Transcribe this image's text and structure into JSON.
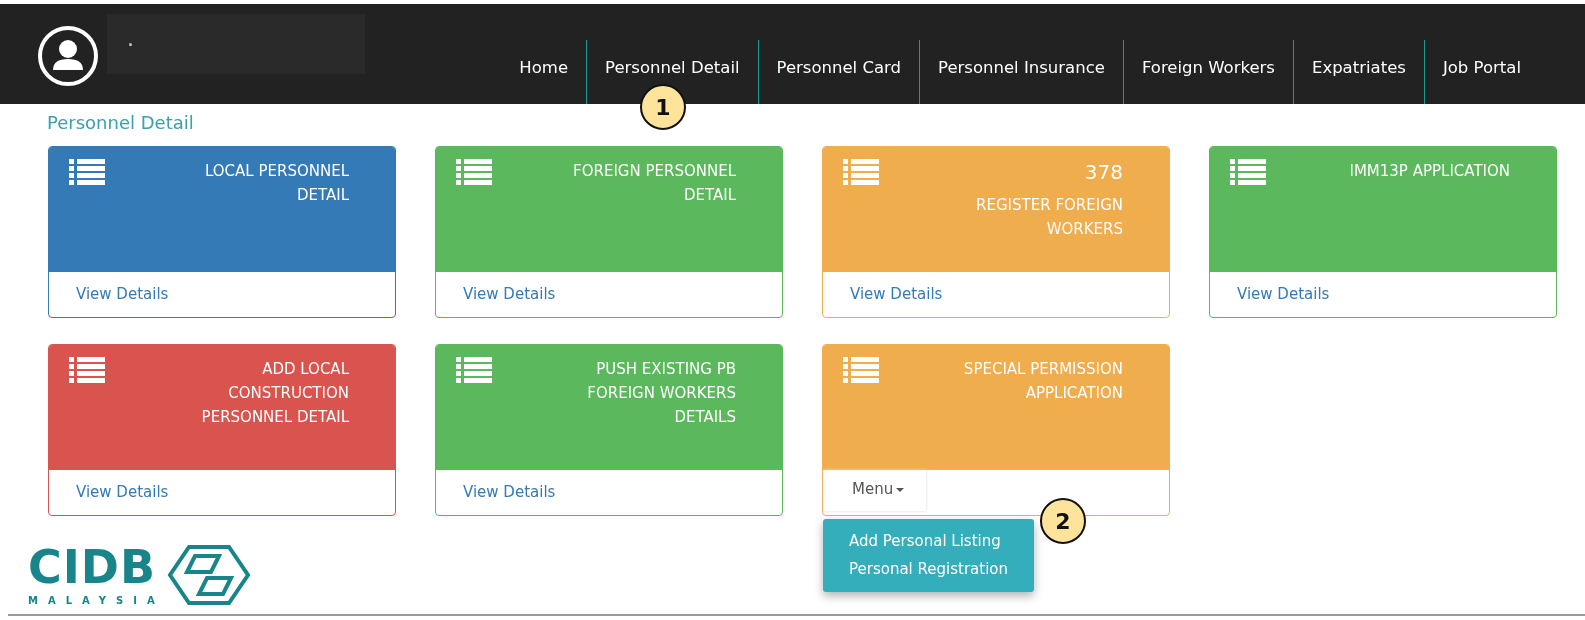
{
  "header": {
    "user_name": "."
  },
  "nav": [
    {
      "label": "Home",
      "selected": false
    },
    {
      "label": "Personnel Detail",
      "selected": false
    },
    {
      "label": "Personnel Card",
      "selected": false
    },
    {
      "label": "Personnel Insurance",
      "selected": false
    },
    {
      "label": "Foreign Workers",
      "selected": false
    },
    {
      "label": "Expatriates",
      "selected": false
    },
    {
      "label": "Job Portal",
      "selected": false
    }
  ],
  "page_title": "Personnel Detail",
  "cards": [
    {
      "title": "LOCAL PERSONNEL DETAIL",
      "color": "#337ab7",
      "footer": {
        "kind": "link",
        "label": "View Details"
      }
    },
    {
      "title": "FOREIGN PERSONNEL DETAIL",
      "color": "#5cb85c",
      "footer": {
        "kind": "link",
        "label": "View Details"
      }
    },
    {
      "count": "378",
      "title": "REGISTER FOREIGN WORKERS",
      "color": "#f0ad4e",
      "footer": {
        "kind": "link",
        "label": "View Details"
      }
    },
    {
      "title": "IMM13P APPLICATION",
      "color": "#5cb85c",
      "footer": {
        "kind": "link",
        "label": "View Details"
      }
    },
    {
      "title": "ADD LOCAL CONSTRUCTION PERSONNEL DETAIL",
      "color": "#d9534f",
      "footer": {
        "kind": "link",
        "label": "View Details"
      }
    },
    {
      "title": "PUSH EXISTING PB FOREIGN WORKERS DETAILS",
      "color": "#5cb85c",
      "footer": {
        "kind": "link",
        "label": "View Details"
      }
    },
    {
      "title": "SPECIAL PERMISSION APPLICATION",
      "color": "#f0ad4e",
      "footer": {
        "kind": "menu",
        "label": "Menu",
        "expanded": true,
        "items": [
          "Add Personal Listing",
          "Personal Registration"
        ]
      }
    }
  ],
  "logo": {
    "name": "CIDB",
    "country": "MALAYSIA"
  },
  "callouts": [
    "1",
    "2"
  ]
}
